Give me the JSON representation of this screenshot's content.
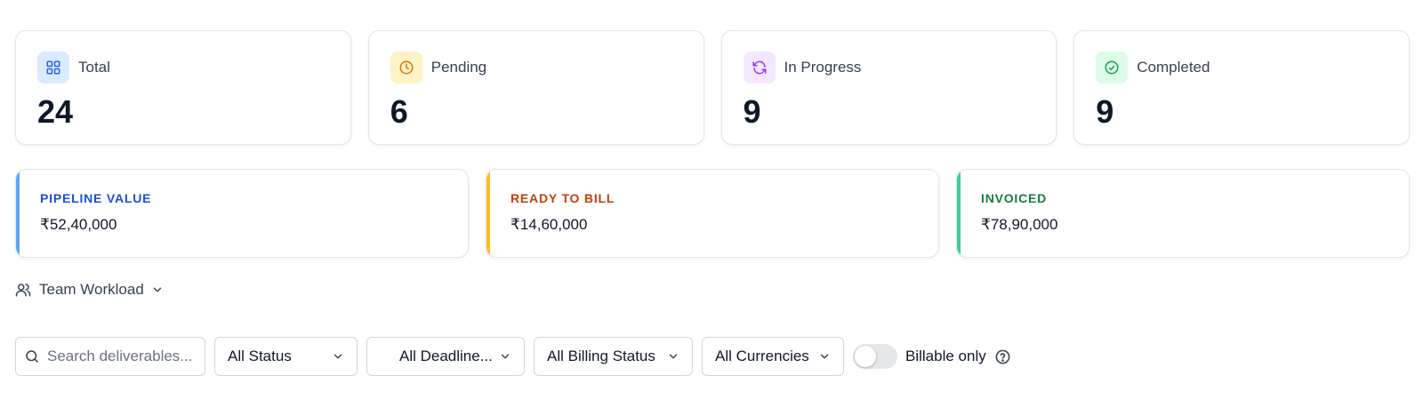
{
  "stats": [
    {
      "label": "Total",
      "value": "24",
      "icon": "grid-icon",
      "icon_bg": "#dbeafe",
      "icon_color": "#2563eb"
    },
    {
      "label": "Pending",
      "value": "6",
      "icon": "clock-icon",
      "icon_bg": "#fef3c7",
      "icon_color": "#d97706"
    },
    {
      "label": "In Progress",
      "value": "9",
      "icon": "refresh-icon",
      "icon_bg": "#f3e8ff",
      "icon_color": "#9333ea"
    },
    {
      "label": "Completed",
      "value": "9",
      "icon": "check-circle-icon",
      "icon_bg": "#dcfce7",
      "icon_color": "#16a34a"
    }
  ],
  "money": [
    {
      "label": "PIPELINE VALUE",
      "value": "₹52,40,000",
      "color": "#1d4ed8",
      "accent": "#60a5fa"
    },
    {
      "label": "READY TO BILL",
      "value": "₹14,60,000",
      "color": "#c2410c",
      "accent": "#fbbf24"
    },
    {
      "label": "INVOICED",
      "value": "₹78,90,000",
      "color": "#15803d",
      "accent": "#34d399"
    }
  ],
  "workload": {
    "label": "Team Workload",
    "icon": "users-icon"
  },
  "filters": {
    "search_placeholder": "Search deliverables...",
    "status": "All Status",
    "deadline": "All Deadline...",
    "billing": "All Billing Status",
    "currency": "All Currencies",
    "billable_label": "Billable only",
    "billable_on": false
  }
}
